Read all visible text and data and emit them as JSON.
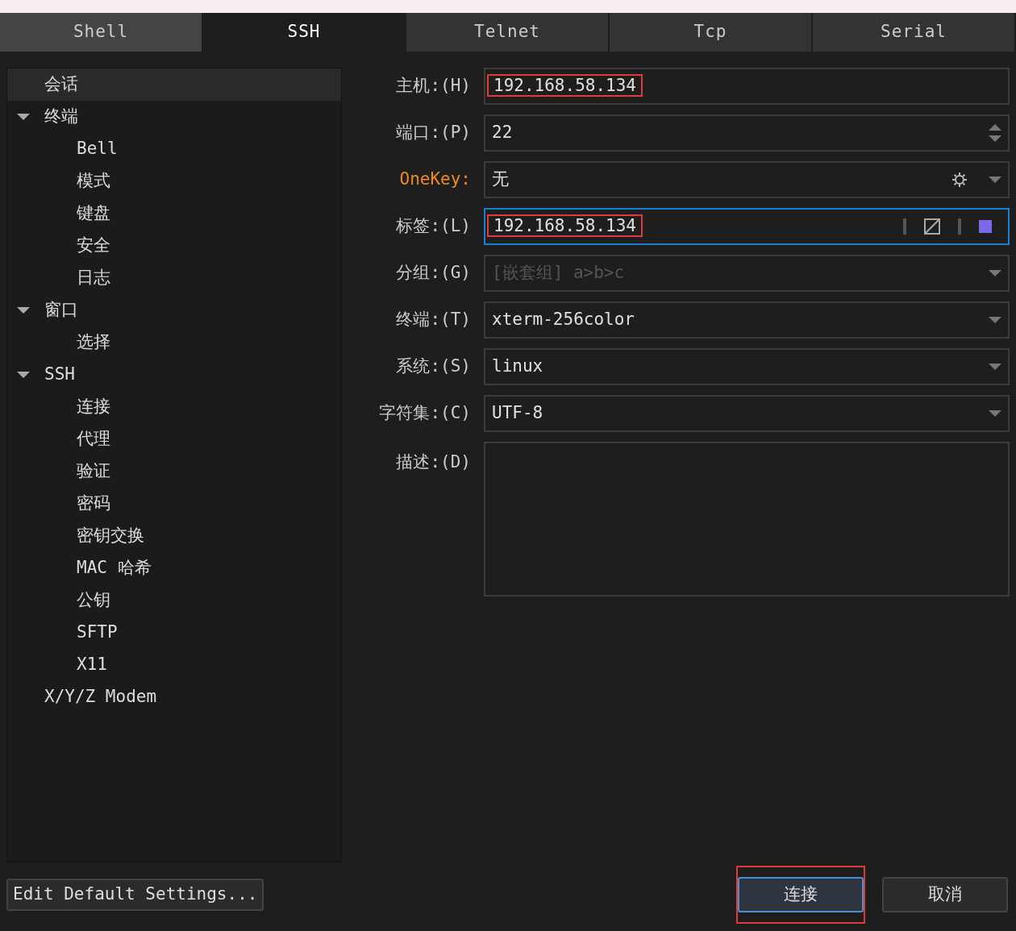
{
  "tabs": [
    {
      "label": "Shell",
      "selected": false
    },
    {
      "label": "SSH",
      "selected": true
    },
    {
      "label": "Telnet",
      "selected": false
    },
    {
      "label": "Tcp",
      "selected": false
    },
    {
      "label": "Serial",
      "selected": false
    }
  ],
  "tree": [
    {
      "label": "会话",
      "selected": true
    },
    {
      "label": "终端",
      "expanded": true,
      "children": [
        {
          "label": "Bell"
        },
        {
          "label": "模式"
        },
        {
          "label": "键盘"
        },
        {
          "label": "安全"
        },
        {
          "label": "日志"
        }
      ]
    },
    {
      "label": "窗口",
      "expanded": true,
      "children": [
        {
          "label": "选择"
        }
      ]
    },
    {
      "label": "SSH",
      "expanded": true,
      "children": [
        {
          "label": "连接"
        },
        {
          "label": "代理"
        },
        {
          "label": "验证"
        },
        {
          "label": "密码"
        },
        {
          "label": "密钥交换"
        },
        {
          "label": "MAC 哈希"
        },
        {
          "label": "公钥"
        },
        {
          "label": "SFTP"
        },
        {
          "label": "X11"
        }
      ]
    },
    {
      "label": "X/Y/Z Modem",
      "selected": false
    }
  ],
  "fields": [
    {
      "label": "主机:(H)",
      "kind": "text",
      "value": "192.168.58.134",
      "highlighted": true,
      "focused": false
    },
    {
      "label": "端口:(P)",
      "kind": "spinner",
      "value": "22"
    },
    {
      "label": "OneKey:",
      "kind": "gear-select",
      "value": "无",
      "accent": true
    },
    {
      "label": "标签:(L)",
      "kind": "tagged",
      "value": "192.168.58.134",
      "highlighted": true,
      "focused": true,
      "color": "#7b68ee"
    },
    {
      "label": "分组:(G)",
      "kind": "select",
      "placeholder": "[嵌套组] a>b>c"
    },
    {
      "label": "终端:(T)",
      "kind": "select",
      "value": "xterm-256color"
    },
    {
      "label": "系统:(S)",
      "kind": "select",
      "value": "linux"
    },
    {
      "label": "字符集:(C)",
      "kind": "select",
      "value": "UTF-8"
    },
    {
      "label": "描述:(D)",
      "kind": "textarea"
    }
  ],
  "edit_defaults_button": "Edit Default Settings...",
  "connect_button": {
    "label": "连接",
    "highlighted": true
  },
  "cancel_button": "取消"
}
